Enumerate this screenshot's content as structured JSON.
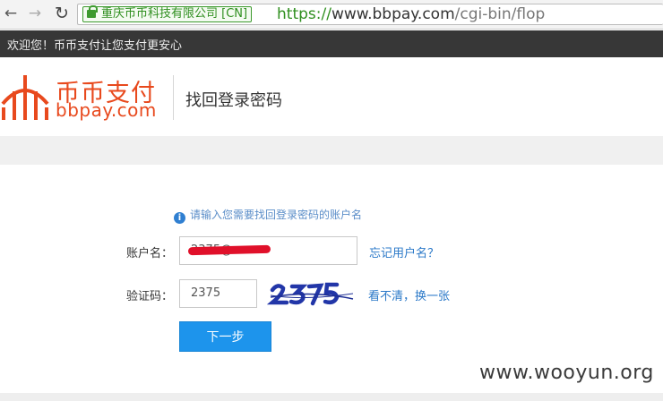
{
  "browser": {
    "ev_cert": "重庆币币科技有限公司 [CN]",
    "url_scheme": "https://",
    "url_host": "www.bbpay.com",
    "url_path": "/cgi-bin/flop"
  },
  "topbar": {
    "welcome": "欢迎您！币币支付让您支付更安心"
  },
  "header": {
    "logo_cn": "币币支付",
    "logo_en": "bbpay.com",
    "page_title": "找回登录密码"
  },
  "form": {
    "hint": "请输入您需要找回登录密码的账户名",
    "account_label": "账户名：",
    "account_value": "2375@",
    "forgot_link": "忘记用户名？",
    "captcha_label": "验证码：",
    "captcha_value": "2375",
    "captcha_image_text": "2375",
    "refresh_link": "看不清，换一张",
    "next_button": "下一步"
  },
  "watermark": "www.wooyun.org",
  "colors": {
    "brand": "#e8491d",
    "link": "#2a78c8",
    "button": "#1d94ec",
    "ev_green": "#2f8f1f"
  },
  "icons": [
    "back-arrow-icon",
    "forward-arrow-icon",
    "reload-icon",
    "lock-icon",
    "info-icon",
    "bbpay-logo-icon"
  ]
}
